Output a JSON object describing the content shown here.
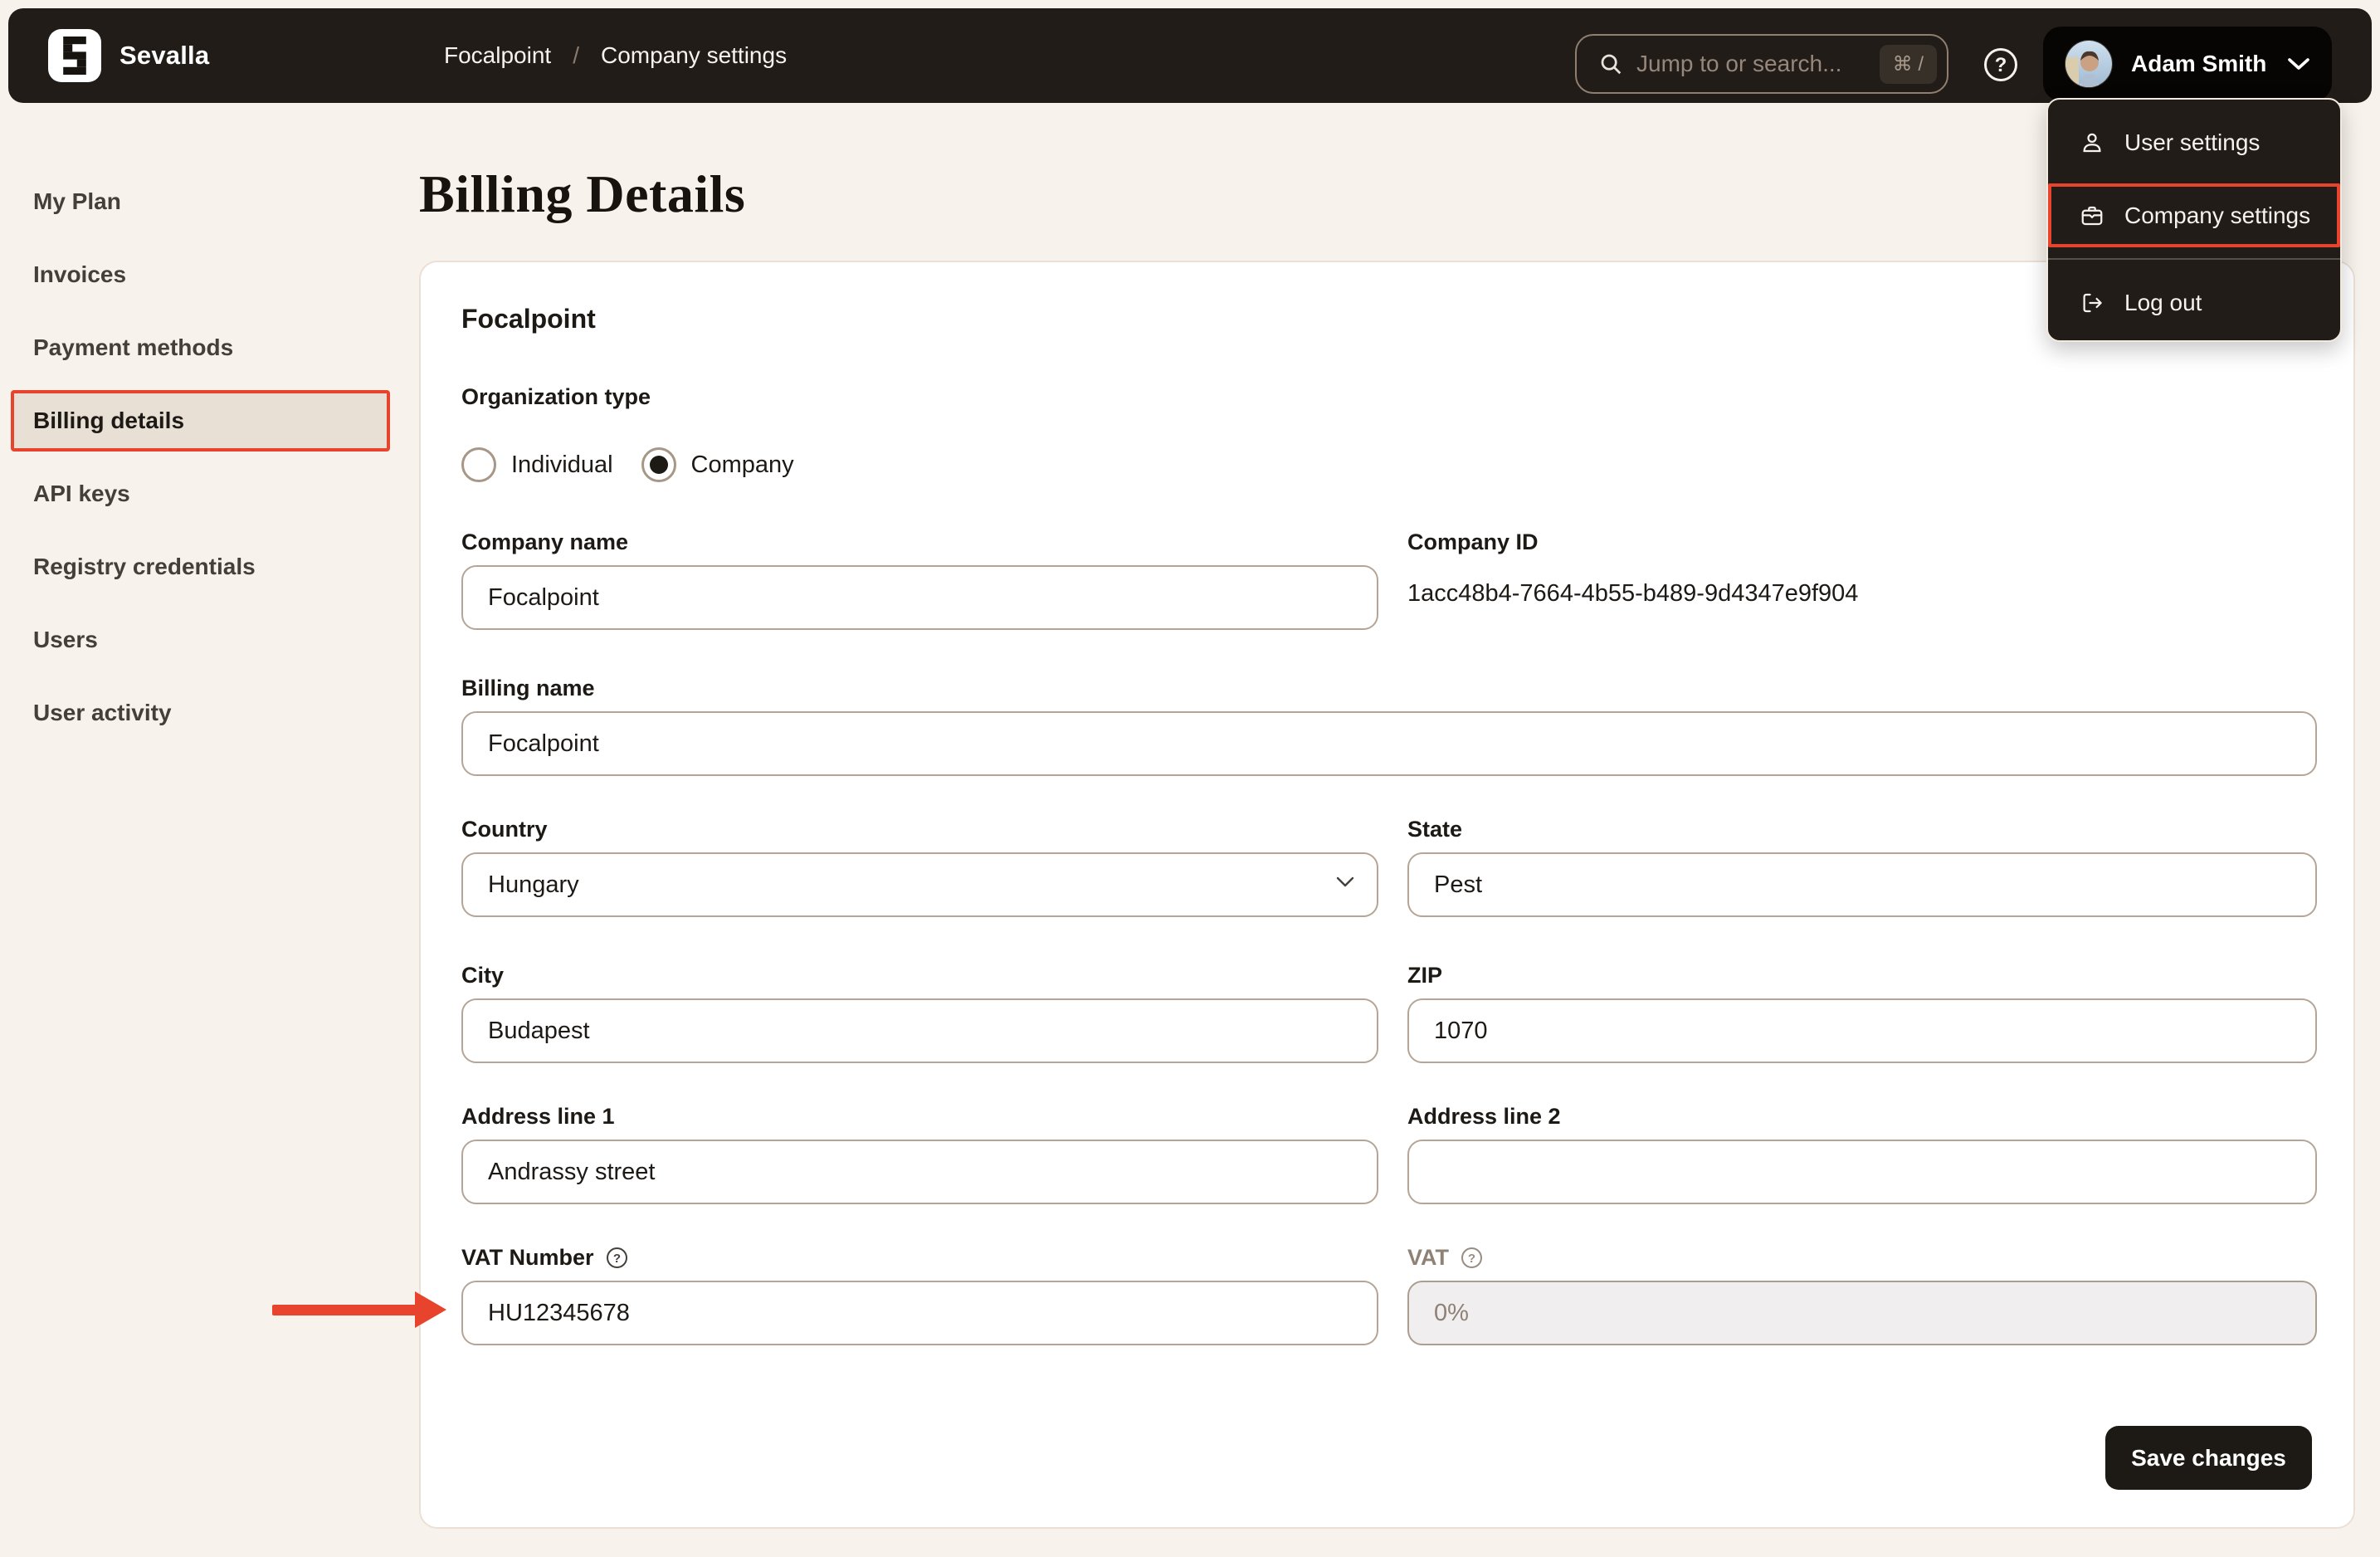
{
  "header": {
    "brand": "Sevalla",
    "breadcrumb": {
      "items": [
        "Focalpoint",
        "Company settings"
      ],
      "separator": "/"
    },
    "search": {
      "placeholder": "Jump to or search...",
      "shortcut": "⌘ /"
    },
    "user": {
      "name": "Adam Smith"
    }
  },
  "user_menu": {
    "items": [
      {
        "label": "User settings",
        "icon": "user-icon",
        "highlighted": false
      },
      {
        "label": "Company settings",
        "icon": "briefcase-icon",
        "highlighted": true
      },
      {
        "label": "Log out",
        "icon": "logout-icon",
        "highlighted": false
      }
    ]
  },
  "sidebar": {
    "items": [
      {
        "label": "My Plan",
        "active": false
      },
      {
        "label": "Invoices",
        "active": false
      },
      {
        "label": "Payment methods",
        "active": false
      },
      {
        "label": "Billing details",
        "active": true
      },
      {
        "label": "API keys",
        "active": false
      },
      {
        "label": "Registry credentials",
        "active": false
      },
      {
        "label": "Users",
        "active": false
      },
      {
        "label": "User activity",
        "active": false
      }
    ]
  },
  "page": {
    "title": "Billing Details"
  },
  "form": {
    "company_heading": "Focalpoint",
    "organization_type": {
      "label": "Organization type",
      "options": [
        {
          "label": "Individual",
          "selected": false
        },
        {
          "label": "Company",
          "selected": true
        }
      ]
    },
    "fields": {
      "company_name": {
        "label": "Company name",
        "value": "Focalpoint"
      },
      "company_id": {
        "label": "Company ID",
        "value": "1acc48b4-7664-4b55-b489-9d4347e9f904"
      },
      "billing_name": {
        "label": "Billing name",
        "value": "Focalpoint"
      },
      "country": {
        "label": "Country",
        "value": "Hungary"
      },
      "state": {
        "label": "State",
        "value": "Pest"
      },
      "city": {
        "label": "City",
        "value": "Budapest"
      },
      "zip": {
        "label": "ZIP",
        "value": "1070"
      },
      "address1": {
        "label": "Address line 1",
        "value": "Andrassy street"
      },
      "address2": {
        "label": "Address line 2",
        "value": ""
      },
      "vat_number": {
        "label": "VAT Number",
        "value": "HU12345678"
      },
      "vat": {
        "label": "VAT",
        "value": "0%",
        "disabled": true
      }
    },
    "save_label": "Save changes"
  },
  "colors": {
    "accent_red": "#e8432c",
    "header_bg": "#211c18",
    "page_bg": "#f8f2ec",
    "active_item_bg": "#e8dfd5",
    "input_border": "#b5a596"
  }
}
